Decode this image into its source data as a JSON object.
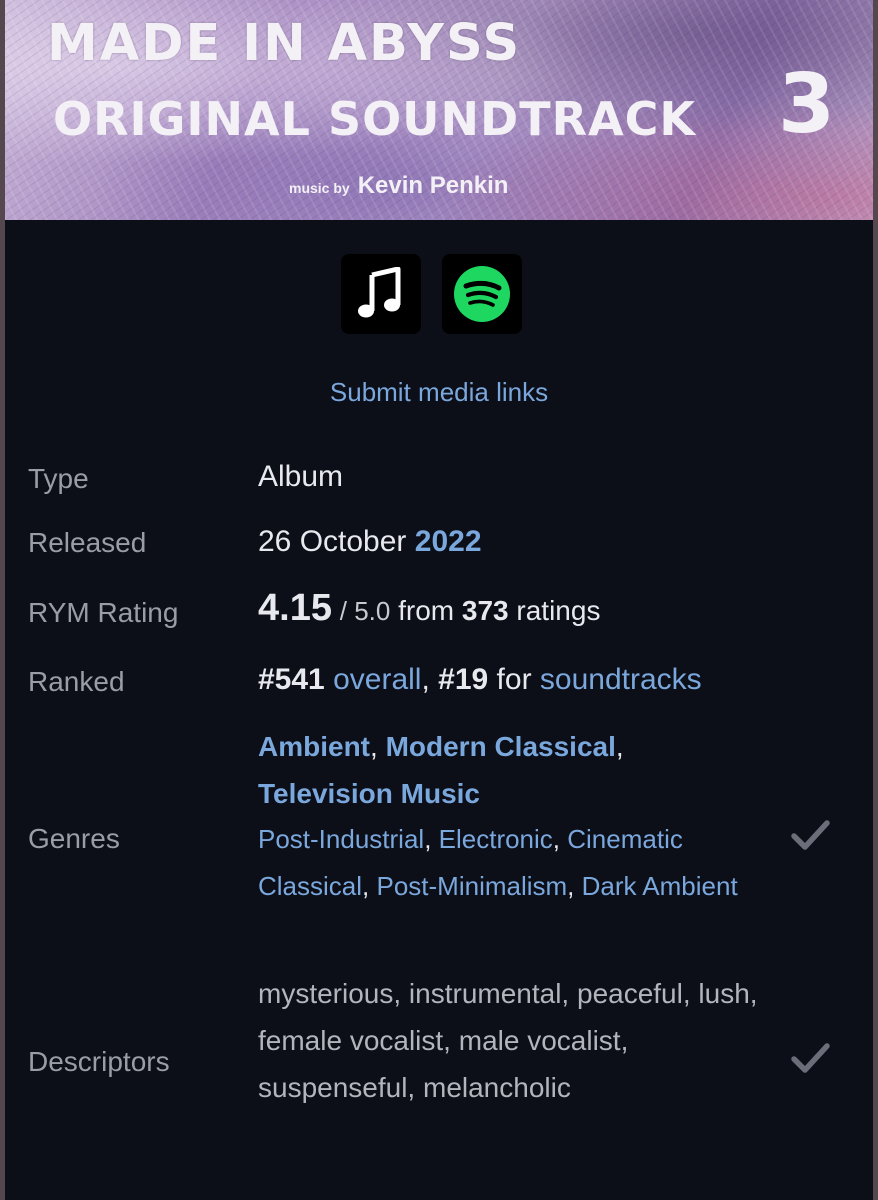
{
  "cover": {
    "title": "MADE IN ABYSS",
    "subtitle": "ORIGINAL SOUNDTRACK",
    "volume": "3",
    "credit_prefix": "music by",
    "credit_name": "Kevin Penkin"
  },
  "media": {
    "apple_icon": "apple-music-icon",
    "spotify_icon": "spotify-icon",
    "spotify_color": "#1ed760",
    "submit_label": "Submit media links"
  },
  "details": {
    "type_label": "Type",
    "type_value": "Album",
    "released_label": "Released",
    "released_day_month": "26 October",
    "released_year": "2022",
    "rating_label": "RYM Rating",
    "rating_value": "4.15",
    "rating_scale": "/ 5.0",
    "rating_from": "from",
    "rating_count": "373",
    "rating_suffix": "ratings",
    "ranked_label": "Ranked",
    "rank_overall": "#541",
    "rank_overall_link": "overall",
    "rank_genre": "#19",
    "rank_for": "for",
    "rank_genre_link": "soundtracks",
    "genres_label": "Genres",
    "primary_genres": [
      "Ambient",
      "Modern Classical",
      "Television Music"
    ],
    "secondary_genres": [
      "Post-Industrial",
      "Electronic",
      "Cinematic Classical",
      "Post-Minimalism",
      "Dark Ambient"
    ],
    "descriptors_label": "Descriptors",
    "descriptors": "mysterious, instrumental, peaceful, lush, female vocalist, male vocalist, suspenseful, melancholic"
  },
  "colors": {
    "background": "#0c0e18",
    "link": "#7aa7dc",
    "label": "#9a9ca6",
    "text": "#e8e9ee"
  }
}
